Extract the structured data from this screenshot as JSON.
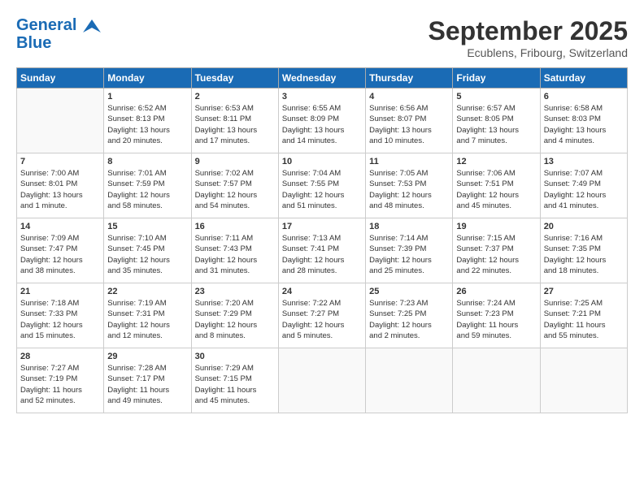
{
  "header": {
    "logo_line1": "General",
    "logo_line2": "Blue",
    "month": "September 2025",
    "location": "Ecublens, Fribourg, Switzerland"
  },
  "weekdays": [
    "Sunday",
    "Monday",
    "Tuesday",
    "Wednesday",
    "Thursday",
    "Friday",
    "Saturday"
  ],
  "weeks": [
    [
      {
        "day": "",
        "info": ""
      },
      {
        "day": "1",
        "info": "Sunrise: 6:52 AM\nSunset: 8:13 PM\nDaylight: 13 hours\nand 20 minutes."
      },
      {
        "day": "2",
        "info": "Sunrise: 6:53 AM\nSunset: 8:11 PM\nDaylight: 13 hours\nand 17 minutes."
      },
      {
        "day": "3",
        "info": "Sunrise: 6:55 AM\nSunset: 8:09 PM\nDaylight: 13 hours\nand 14 minutes."
      },
      {
        "day": "4",
        "info": "Sunrise: 6:56 AM\nSunset: 8:07 PM\nDaylight: 13 hours\nand 10 minutes."
      },
      {
        "day": "5",
        "info": "Sunrise: 6:57 AM\nSunset: 8:05 PM\nDaylight: 13 hours\nand 7 minutes."
      },
      {
        "day": "6",
        "info": "Sunrise: 6:58 AM\nSunset: 8:03 PM\nDaylight: 13 hours\nand 4 minutes."
      }
    ],
    [
      {
        "day": "7",
        "info": "Sunrise: 7:00 AM\nSunset: 8:01 PM\nDaylight: 13 hours\nand 1 minute."
      },
      {
        "day": "8",
        "info": "Sunrise: 7:01 AM\nSunset: 7:59 PM\nDaylight: 12 hours\nand 58 minutes."
      },
      {
        "day": "9",
        "info": "Sunrise: 7:02 AM\nSunset: 7:57 PM\nDaylight: 12 hours\nand 54 minutes."
      },
      {
        "day": "10",
        "info": "Sunrise: 7:04 AM\nSunset: 7:55 PM\nDaylight: 12 hours\nand 51 minutes."
      },
      {
        "day": "11",
        "info": "Sunrise: 7:05 AM\nSunset: 7:53 PM\nDaylight: 12 hours\nand 48 minutes."
      },
      {
        "day": "12",
        "info": "Sunrise: 7:06 AM\nSunset: 7:51 PM\nDaylight: 12 hours\nand 45 minutes."
      },
      {
        "day": "13",
        "info": "Sunrise: 7:07 AM\nSunset: 7:49 PM\nDaylight: 12 hours\nand 41 minutes."
      }
    ],
    [
      {
        "day": "14",
        "info": "Sunrise: 7:09 AM\nSunset: 7:47 PM\nDaylight: 12 hours\nand 38 minutes."
      },
      {
        "day": "15",
        "info": "Sunrise: 7:10 AM\nSunset: 7:45 PM\nDaylight: 12 hours\nand 35 minutes."
      },
      {
        "day": "16",
        "info": "Sunrise: 7:11 AM\nSunset: 7:43 PM\nDaylight: 12 hours\nand 31 minutes."
      },
      {
        "day": "17",
        "info": "Sunrise: 7:13 AM\nSunset: 7:41 PM\nDaylight: 12 hours\nand 28 minutes."
      },
      {
        "day": "18",
        "info": "Sunrise: 7:14 AM\nSunset: 7:39 PM\nDaylight: 12 hours\nand 25 minutes."
      },
      {
        "day": "19",
        "info": "Sunrise: 7:15 AM\nSunset: 7:37 PM\nDaylight: 12 hours\nand 22 minutes."
      },
      {
        "day": "20",
        "info": "Sunrise: 7:16 AM\nSunset: 7:35 PM\nDaylight: 12 hours\nand 18 minutes."
      }
    ],
    [
      {
        "day": "21",
        "info": "Sunrise: 7:18 AM\nSunset: 7:33 PM\nDaylight: 12 hours\nand 15 minutes."
      },
      {
        "day": "22",
        "info": "Sunrise: 7:19 AM\nSunset: 7:31 PM\nDaylight: 12 hours\nand 12 minutes."
      },
      {
        "day": "23",
        "info": "Sunrise: 7:20 AM\nSunset: 7:29 PM\nDaylight: 12 hours\nand 8 minutes."
      },
      {
        "day": "24",
        "info": "Sunrise: 7:22 AM\nSunset: 7:27 PM\nDaylight: 12 hours\nand 5 minutes."
      },
      {
        "day": "25",
        "info": "Sunrise: 7:23 AM\nSunset: 7:25 PM\nDaylight: 12 hours\nand 2 minutes."
      },
      {
        "day": "26",
        "info": "Sunrise: 7:24 AM\nSunset: 7:23 PM\nDaylight: 11 hours\nand 59 minutes."
      },
      {
        "day": "27",
        "info": "Sunrise: 7:25 AM\nSunset: 7:21 PM\nDaylight: 11 hours\nand 55 minutes."
      }
    ],
    [
      {
        "day": "28",
        "info": "Sunrise: 7:27 AM\nSunset: 7:19 PM\nDaylight: 11 hours\nand 52 minutes."
      },
      {
        "day": "29",
        "info": "Sunrise: 7:28 AM\nSunset: 7:17 PM\nDaylight: 11 hours\nand 49 minutes."
      },
      {
        "day": "30",
        "info": "Sunrise: 7:29 AM\nSunset: 7:15 PM\nDaylight: 11 hours\nand 45 minutes."
      },
      {
        "day": "",
        "info": ""
      },
      {
        "day": "",
        "info": ""
      },
      {
        "day": "",
        "info": ""
      },
      {
        "day": "",
        "info": ""
      }
    ]
  ]
}
